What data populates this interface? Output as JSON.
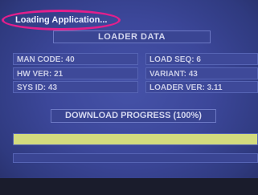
{
  "app": {
    "title": "Loading Application..."
  },
  "loader": {
    "header": "LOADER DATA",
    "rows": [
      {
        "left": "MAN CODE: 40",
        "right": "LOAD SEQ: 6"
      },
      {
        "left": "HW VER: 21",
        "right": "VARIANT: 43"
      },
      {
        "left": "SYS ID: 43",
        "right": "LOADER VER: 3.11"
      }
    ]
  },
  "download": {
    "header": "DOWNLOAD PROGRESS (100%)",
    "progress_percent": 100
  },
  "colors": {
    "highlight_ellipse": "#e21f8c",
    "progress_fill": "#d3db7e",
    "background": "#3c479a"
  }
}
